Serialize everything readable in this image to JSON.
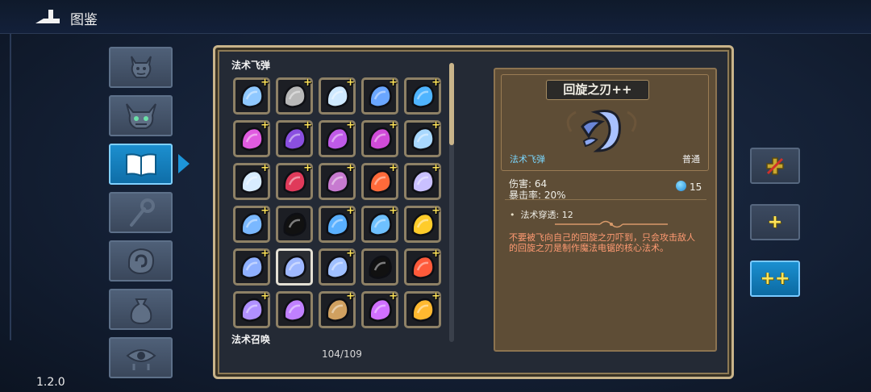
{
  "header": {
    "title": "图鉴",
    "back_icon": "back-arrow-icon"
  },
  "version": "1.2.0",
  "categories": [
    {
      "icon": "imp-face-icon",
      "active": false
    },
    {
      "icon": "horned-demon-icon",
      "active": false
    },
    {
      "icon": "open-book-icon",
      "active": true
    },
    {
      "icon": "magic-staff-icon",
      "active": false
    },
    {
      "icon": "spell-rune-hand-icon",
      "active": false
    },
    {
      "icon": "pouch-icon",
      "active": false
    },
    {
      "icon": "crying-eye-icon",
      "active": false
    }
  ],
  "codex": {
    "section_1": "法术飞弹",
    "section_2": "法术召唤",
    "counter": "104/109",
    "plus_mark": "+"
  },
  "detail": {
    "name": "回旋之刃++",
    "type": "法术飞弹",
    "rarity": "普通",
    "damage": "伤害: 64",
    "crit": "暴击率: 20%",
    "mana_cost": "15",
    "penetration": "法术穿透: 12",
    "description": "不要被飞向自己的回旋之刃吓到，只会攻击敌人的回旋之刃是制作魔法电锯的核心法术。"
  },
  "side_buttons": [
    {
      "icon": "no-upgrade-icon",
      "active": false
    },
    {
      "icon": "single-plus-icon",
      "label": "+",
      "active": false
    },
    {
      "icon": "double-plus-icon",
      "label": "++",
      "active": true
    }
  ],
  "colors": {
    "accent": "#1d95d9",
    "gold_frame": "#c9b48a",
    "plus_yellow": "#ffe45a",
    "desc_text": "#ff9a72",
    "type_text": "#7ad7ff"
  },
  "grid": [
    [
      {
        "icon": "frost-orb-icon",
        "plus": true,
        "color": "#8fc8ff"
      },
      {
        "icon": "stone-ball-icon",
        "plus": true,
        "color": "#b8b8b8"
      },
      {
        "icon": "butterfly-icon",
        "plus": true,
        "color": "#cfe9ff"
      },
      {
        "icon": "light-wand-icon",
        "plus": true,
        "color": "#6aa6ff"
      },
      {
        "icon": "blue-spiral-icon",
        "plus": true,
        "color": "#4fb4ff"
      }
    ],
    [
      {
        "icon": "pink-flame-icon",
        "plus": true,
        "color": "#e05be0"
      },
      {
        "icon": "purple-vortex-icon",
        "plus": true,
        "color": "#8a4fe0"
      },
      {
        "icon": "violet-orb-icon",
        "plus": true,
        "color": "#c05ae8"
      },
      {
        "icon": "crossed-blades-icon",
        "plus": true,
        "color": "#d04bd8"
      },
      {
        "icon": "ice-fox-icon",
        "plus": true,
        "color": "#a8d8ff"
      }
    ],
    [
      {
        "icon": "ice-comet-icon",
        "plus": true,
        "color": "#d8ecff"
      },
      {
        "icon": "red-beast-icon",
        "plus": true,
        "color": "#e03a5a"
      },
      {
        "icon": "pink-crystal-icon",
        "plus": true,
        "color": "#c77ad0"
      },
      {
        "icon": "rainbow-icon",
        "plus": true,
        "color": "#ff6a3a"
      },
      {
        "icon": "star-sparkle-icon",
        "plus": true,
        "color": "#c9c0ff"
      }
    ],
    [
      {
        "icon": "water-bolt-icon",
        "plus": true,
        "color": "#7ab8ff"
      },
      {
        "icon": "shadow-creature-icon",
        "plus": false,
        "color": "#111111"
      },
      {
        "icon": "lightning-arc-icon",
        "plus": true,
        "color": "#5ab0ff"
      },
      {
        "icon": "water-wave-icon",
        "plus": true,
        "color": "#6ec0ff"
      },
      {
        "icon": "gold-coin-icon",
        "plus": true,
        "color": "#ffcc2a"
      }
    ],
    [
      {
        "icon": "boomerang-blade-icon",
        "plus": true,
        "color": "#8fb0ff"
      },
      {
        "icon": "boomerang-blade-icon",
        "plus": false,
        "selected": true,
        "color": "#9fb8ff"
      },
      {
        "icon": "cross-blades-icon",
        "plus": true,
        "color": "#a0c0ff"
      },
      {
        "icon": "shadow-blob-icon",
        "plus": false,
        "color": "#111111"
      },
      {
        "icon": "flame-leaf-icon",
        "plus": true,
        "color": "#ff5a3a"
      }
    ],
    [
      {
        "icon": "shooting-arrows-icon",
        "plus": true,
        "color": "#b090ff"
      },
      {
        "icon": "hex-star-icon",
        "plus": false,
        "color": "#c080ff"
      },
      {
        "icon": "arrow-icon",
        "plus": true,
        "color": "#d0a060"
      },
      {
        "icon": "comet-blast-icon",
        "plus": true,
        "color": "#d070ff"
      },
      {
        "icon": "gold-feathers-icon",
        "plus": true,
        "color": "#ffb830"
      }
    ]
  ]
}
